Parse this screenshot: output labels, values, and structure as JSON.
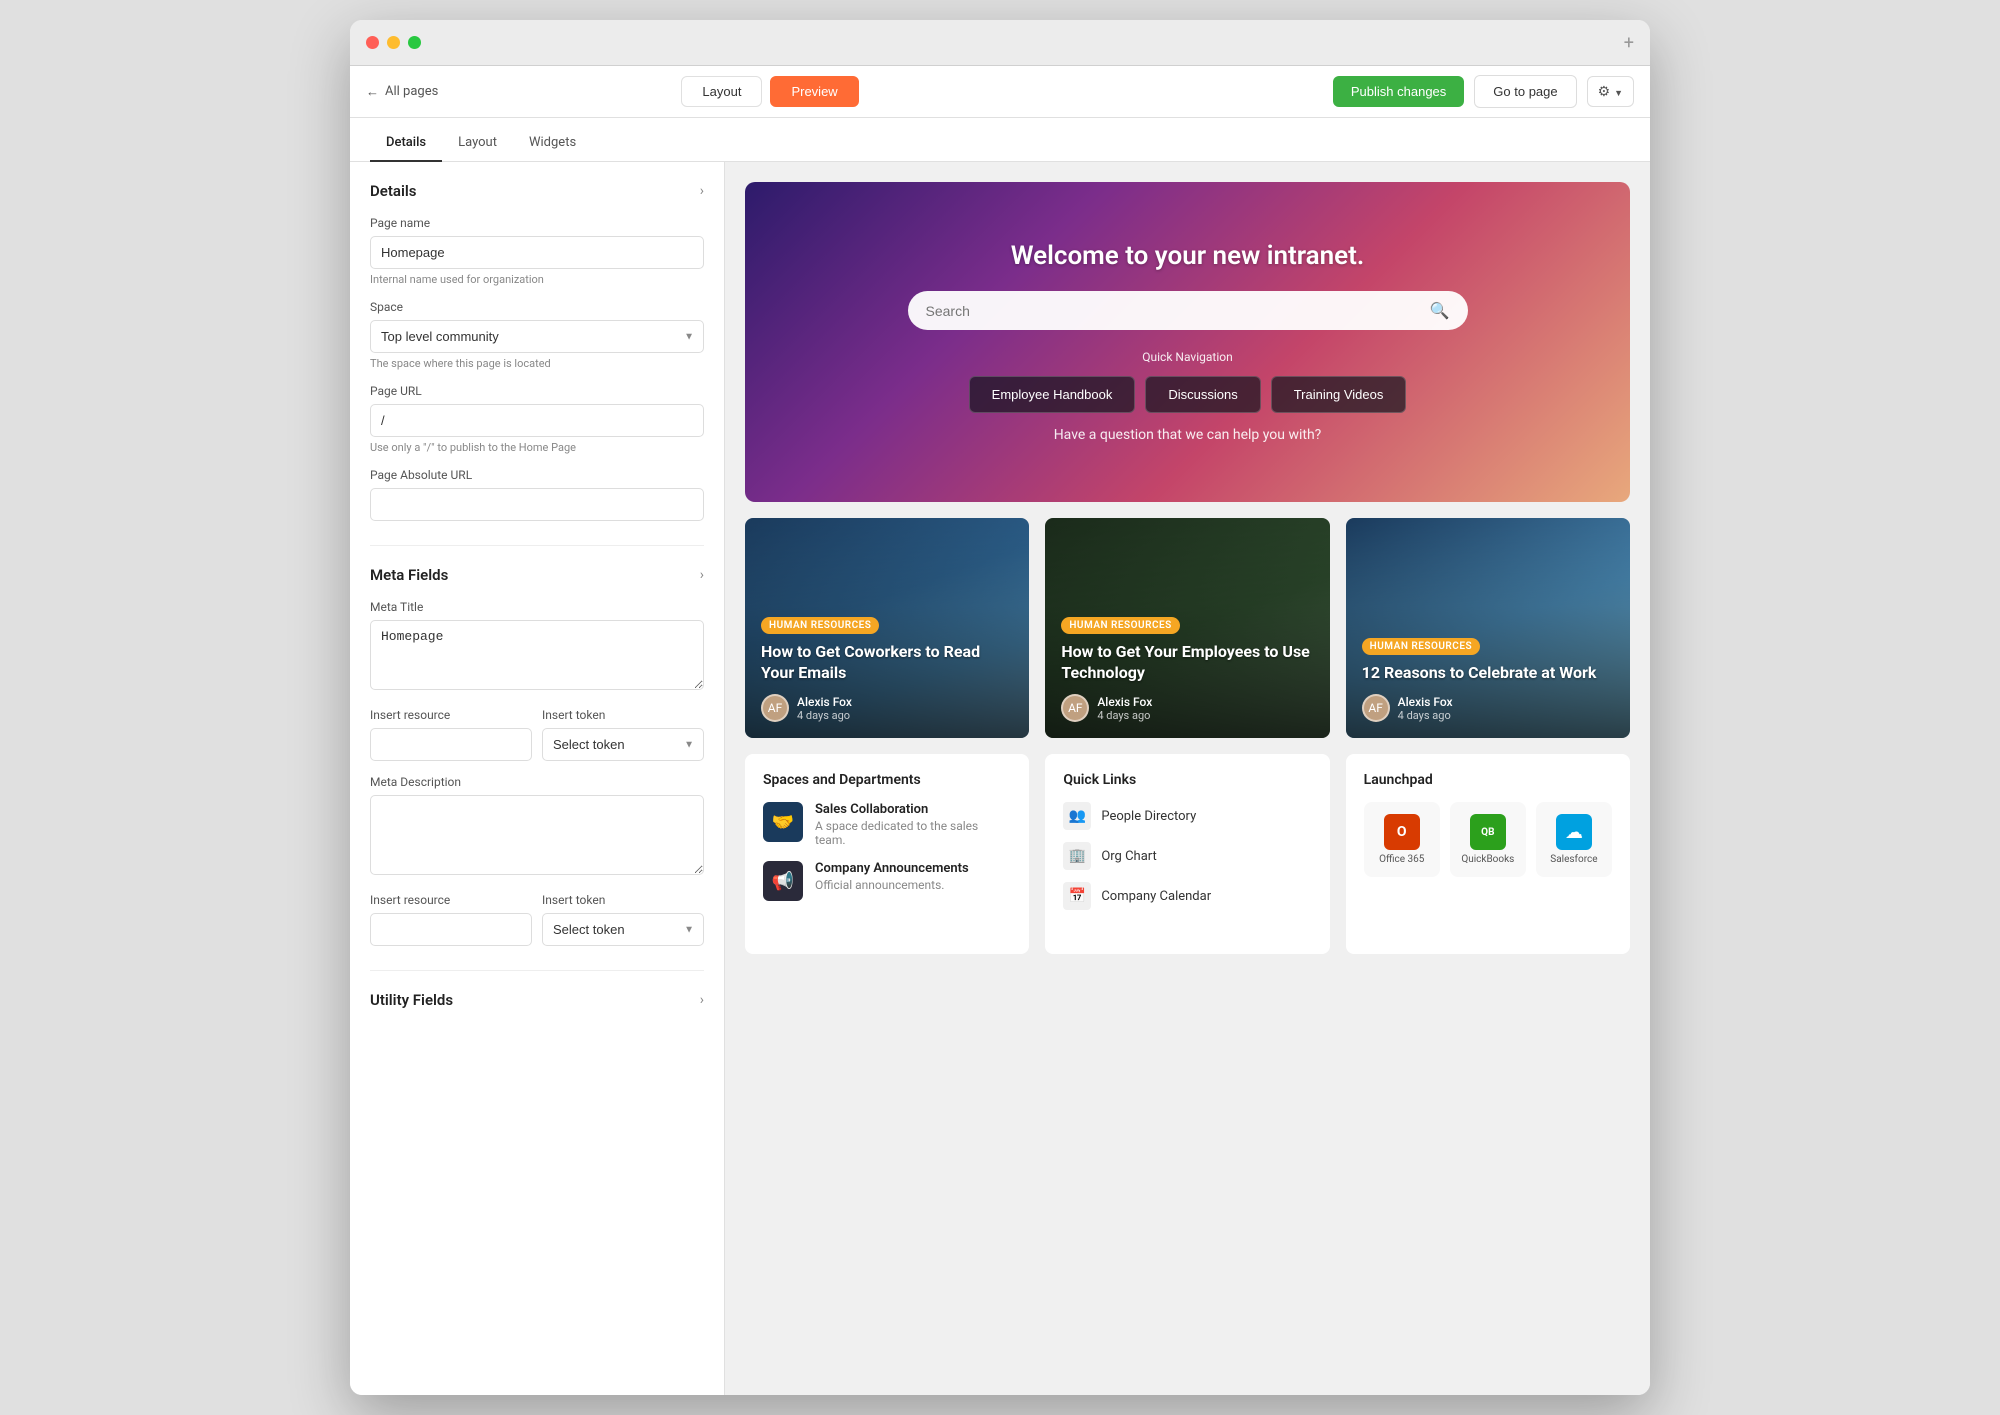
{
  "window": {
    "title": "Homepage Editor"
  },
  "titlebar": {
    "expand_icon": "+"
  },
  "navbar": {
    "back_label": "All pages",
    "layout_label": "Layout",
    "preview_label": "Preview",
    "publish_label": "Publish changes",
    "goto_label": "Go to page",
    "settings_icon": "⚙"
  },
  "tabs": [
    {
      "id": "details",
      "label": "Details",
      "active": true
    },
    {
      "id": "layout",
      "label": "Layout",
      "active": false
    },
    {
      "id": "widgets",
      "label": "Widgets",
      "active": false
    }
  ],
  "sidebar": {
    "details_section": {
      "title": "Details",
      "page_name_label": "Page name",
      "page_name_value": "Homepage",
      "page_name_hint": "Internal name used for organization",
      "space_label": "Space",
      "space_value": "Top level community",
      "space_hint": "The space where this page is located",
      "page_url_label": "Page URL",
      "page_url_value": "/",
      "page_url_hint": "Use only a \"/\" to publish to the Home Page",
      "page_absolute_url_label": "Page Absolute URL",
      "page_absolute_url_value": ""
    },
    "meta_section": {
      "title": "Meta Fields",
      "meta_title_label": "Meta Title",
      "meta_title_value": "Homepage",
      "insert_resource_label": "Insert resource",
      "insert_token_label": "Insert token",
      "select_token_placeholder": "Select token",
      "meta_description_label": "Meta Description",
      "meta_description_value": ""
    },
    "utility_section": {
      "title": "Utility Fields"
    }
  },
  "hero": {
    "title": "Welcome to your new intranet.",
    "search_placeholder": "Search",
    "quick_nav_label": "Quick Navigation",
    "nav_buttons": [
      {
        "label": "Employee Handbook"
      },
      {
        "label": "Discussions"
      },
      {
        "label": "Training Videos"
      }
    ],
    "question": "Have a question that we can help you with?"
  },
  "articles": [
    {
      "tag": "Human Resources",
      "title": "How to Get Coworkers to Read Your Emails",
      "author": "Alexis Fox",
      "time": "4 days ago",
      "bg": "city"
    },
    {
      "tag": "Human Resources",
      "title": "How to Get Your Employees to Use Technology",
      "author": "Alexis Fox",
      "time": "4 days ago",
      "bg": "office"
    },
    {
      "tag": "Human Resources",
      "title": "12 Reasons to Celebrate at Work",
      "author": "Alexis Fox",
      "time": "4 days ago",
      "bg": "road"
    }
  ],
  "spaces": {
    "title": "Spaces and Departments",
    "items": [
      {
        "name": "Sales Collaboration",
        "desc": "A space dedicated to the sales team.",
        "icon": "🤝"
      },
      {
        "name": "Company Announcements",
        "desc": "Official announcements.",
        "icon": "📢"
      }
    ]
  },
  "quick_links": {
    "title": "Quick Links",
    "items": [
      {
        "label": "People Directory",
        "icon": "👥"
      },
      {
        "label": "Org Chart",
        "icon": "🏢"
      },
      {
        "label": "Company Calendar",
        "icon": "📅"
      }
    ]
  },
  "launchpad": {
    "title": "Launchpad",
    "items": [
      {
        "label": "Office 365",
        "type": "o365"
      },
      {
        "label": "QuickBooks",
        "type": "qb"
      },
      {
        "label": "Salesforce",
        "type": "sf"
      }
    ]
  }
}
